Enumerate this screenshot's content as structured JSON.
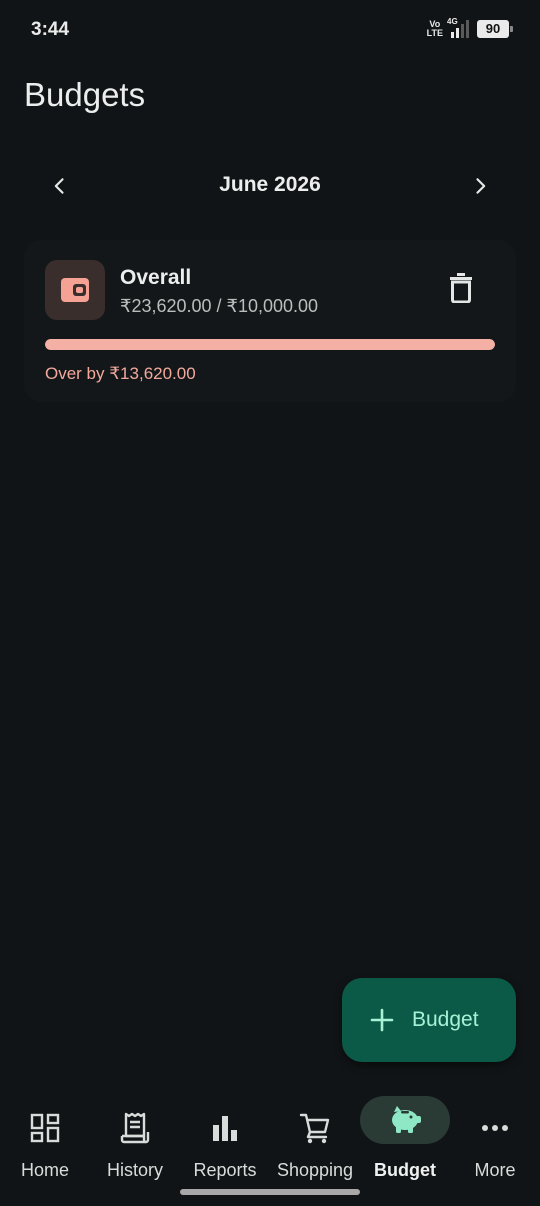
{
  "status_bar": {
    "time": "3:44",
    "volte_top": "Vo",
    "volte_bottom": "LTE",
    "network": "4G",
    "battery": "90"
  },
  "page": {
    "title": "Budgets"
  },
  "month_nav": {
    "label": "June 2026",
    "prev_icon": "chevron-left-icon",
    "next_icon": "chevron-right-icon"
  },
  "budget": {
    "name": "Overall",
    "amount_text": "₹23,620.00 / ₹10,000.00",
    "progress_fraction": 1.0,
    "status_text": "Over by ₹13,620.00",
    "icon": "wallet-icon",
    "accent_color": "#f5b0a5"
  },
  "fab": {
    "label": "Budget",
    "icon": "plus-icon"
  },
  "bottom_nav": {
    "items": [
      {
        "label": "Home",
        "icon": "dashboard-icon"
      },
      {
        "label": "History",
        "icon": "receipt-icon"
      },
      {
        "label": "Reports",
        "icon": "bar-chart-icon"
      },
      {
        "label": "Shopping",
        "icon": "cart-icon"
      },
      {
        "label": "Budget",
        "icon": "piggy-bank-icon",
        "active": true
      },
      {
        "label": "More",
        "icon": "more-horizontal-icon"
      }
    ]
  }
}
